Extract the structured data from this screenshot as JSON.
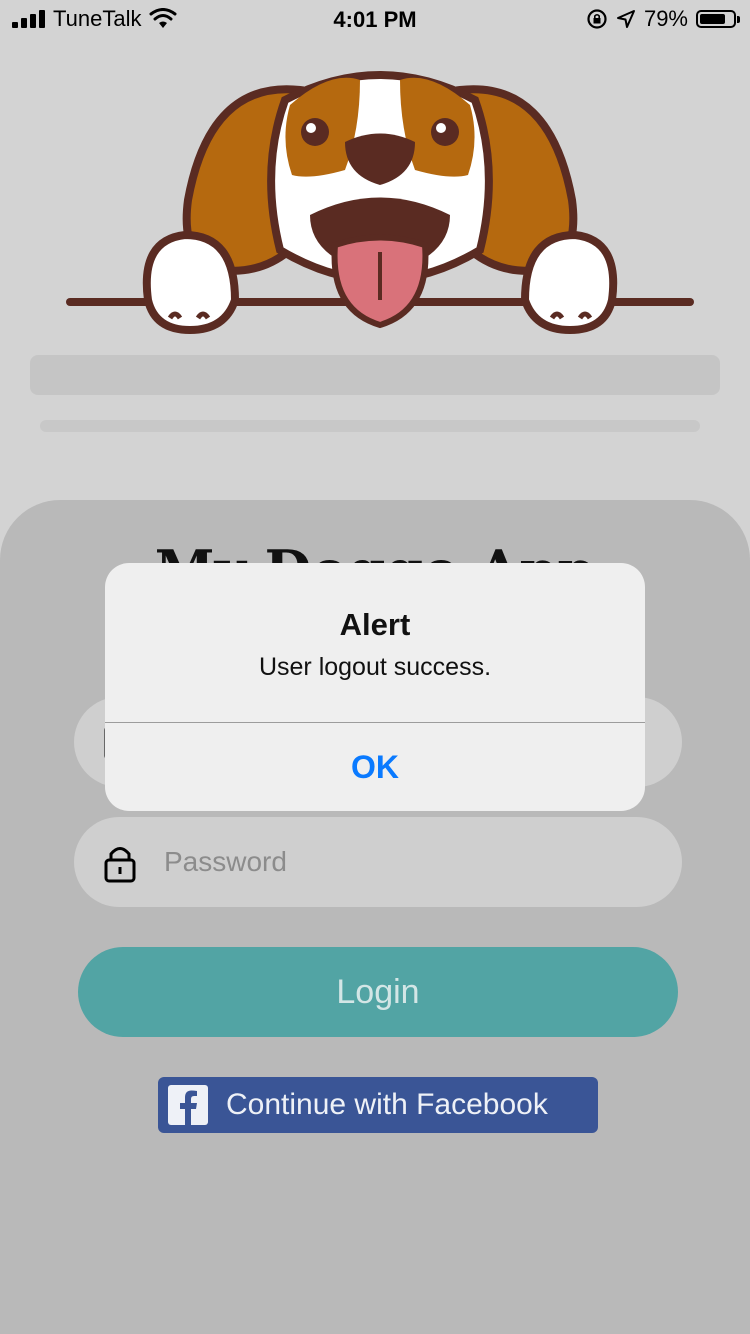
{
  "status_bar": {
    "carrier": "TuneTalk",
    "time": "4:01 PM",
    "battery_percent": "79%",
    "battery_level": 0.79,
    "icons": [
      "signal-icon",
      "wifi-icon",
      "orientation-lock-icon",
      "location-icon",
      "battery-icon"
    ]
  },
  "logo": {
    "icon": "beagle-dog-logo"
  },
  "login_form": {
    "app_title": "My Doggo App",
    "username_icon": "user-card-icon",
    "password_placeholder": "Password",
    "password_icon": "lock-icon",
    "login_label": "Login",
    "facebook_label": "Continue with Facebook",
    "facebook_icon": "facebook-icon"
  },
  "alert": {
    "title": "Alert",
    "message": "User logout success.",
    "ok_label": "OK"
  },
  "colors": {
    "login_button": "#52a4a4",
    "facebook_button": "#3a5596",
    "alert_action": "#0a7aff"
  }
}
